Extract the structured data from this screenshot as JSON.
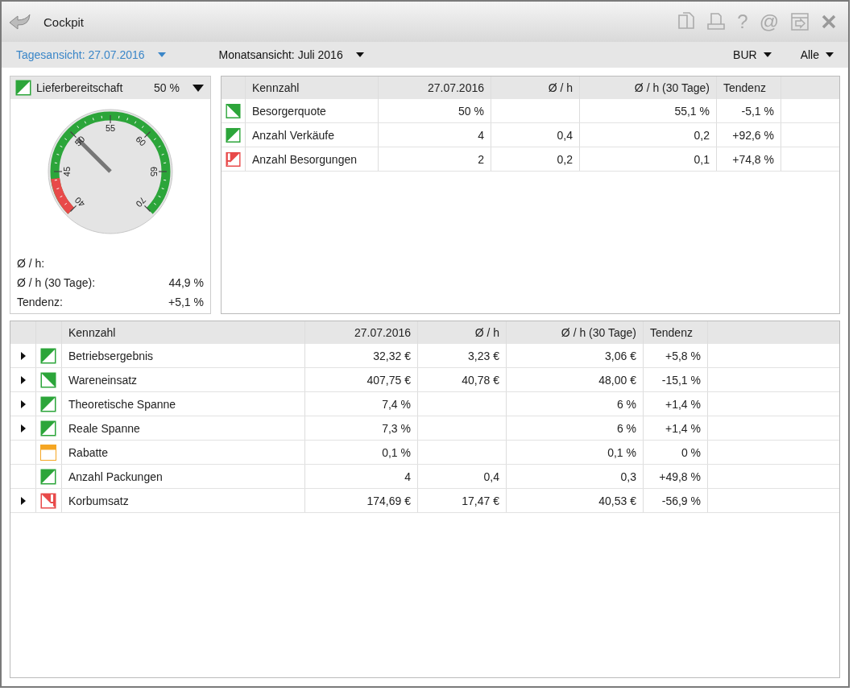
{
  "window": {
    "title": "Cockpit",
    "help_symbol": "?",
    "email_symbol": "@"
  },
  "view_tabs": [
    {
      "label": "Tagesansicht: 27.07.2016",
      "selected": true
    },
    {
      "label": "Monatsansicht: Juli 2016",
      "selected": false
    }
  ],
  "filters": [
    {
      "label": "BUR"
    },
    {
      "label": "Alle"
    }
  ],
  "gauge_panel": {
    "icon": {
      "kind": "up",
      "color": "#2ca53a"
    },
    "title": "Lieferbereitschaft",
    "value": "50 %",
    "gauge": {
      "ticks": [
        "40",
        "45",
        "50",
        "55",
        "60",
        "65",
        "70"
      ],
      "level": 0.333
    },
    "stats": [
      {
        "label": "Ø / h:"
      },
      {
        "label": "Ø / h (30 Tage):",
        "value": "44,9 %"
      },
      {
        "label": "Tendenz:",
        "value": "+5,1 %"
      }
    ]
  },
  "top_table": {
    "columns": [
      "Kennzahl",
      "27.07.2016",
      "Ø / h",
      "Ø / h (30 Tage)",
      "Tendenz"
    ],
    "rows": [
      {
        "icon": {
          "kind": "down",
          "color": "#2ca53a",
          "alert": false
        },
        "cells": [
          "Besorgerquote",
          "50 %",
          "",
          "55,1 %",
          "-5,1 %"
        ]
      },
      {
        "icon": {
          "kind": "up",
          "color": "#2ca53a",
          "alert": false
        },
        "cells": [
          "Anzahl Verkäufe",
          "4",
          "0,4",
          "0,2",
          "+92,6 %"
        ]
      },
      {
        "icon": {
          "kind": "up",
          "color": "#e84a4a",
          "alert": true
        },
        "cells": [
          "Anzahl Besorgungen",
          "2",
          "0,2",
          "0,1",
          "+74,8 %"
        ]
      }
    ]
  },
  "bottom_table": {
    "columns": [
      "Kennzahl",
      "27.07.2016",
      "Ø / h",
      "Ø / h (30 Tage)",
      "Tendenz"
    ],
    "rows": [
      {
        "expandable": true,
        "icon": {
          "kind": "up",
          "color": "#2ca53a",
          "alert": false
        },
        "cells": [
          "Betriebsergebnis",
          "32,32 €",
          "3,23 €",
          "3,06 €",
          "+5,8 %"
        ]
      },
      {
        "expandable": true,
        "icon": {
          "kind": "down",
          "color": "#2ca53a",
          "alert": false
        },
        "cells": [
          "Wareneinsatz",
          "407,75 €",
          "40,78 €",
          "48,00 €",
          "-15,1 %"
        ]
      },
      {
        "expandable": true,
        "icon": {
          "kind": "up",
          "color": "#2ca53a",
          "alert": false
        },
        "cells": [
          "Theoretische Spanne",
          "7,4 %",
          "",
          "6 %",
          "+1,4 %"
        ]
      },
      {
        "expandable": true,
        "icon": {
          "kind": "up",
          "color": "#2ca53a",
          "alert": false
        },
        "cells": [
          "Reale Spanne",
          "7,3 %",
          "",
          "6 %",
          "+1,4 %"
        ]
      },
      {
        "expandable": false,
        "icon": {
          "kind": "flat",
          "color": "#f5a623",
          "alert": false
        },
        "cells": [
          "Rabatte",
          "0,1 %",
          "",
          "0,1 %",
          "0 %"
        ]
      },
      {
        "expandable": false,
        "icon": {
          "kind": "up",
          "color": "#2ca53a",
          "alert": false
        },
        "cells": [
          "Anzahl Packungen",
          "4",
          "0,4",
          "0,3",
          "+49,8 %"
        ]
      },
      {
        "expandable": true,
        "icon": {
          "kind": "down",
          "color": "#e84a4a",
          "alert": true
        },
        "cells": [
          "Korbumsatz",
          "174,69 €",
          "17,47 €",
          "40,53 €",
          "-56,9 %"
        ]
      }
    ]
  }
}
